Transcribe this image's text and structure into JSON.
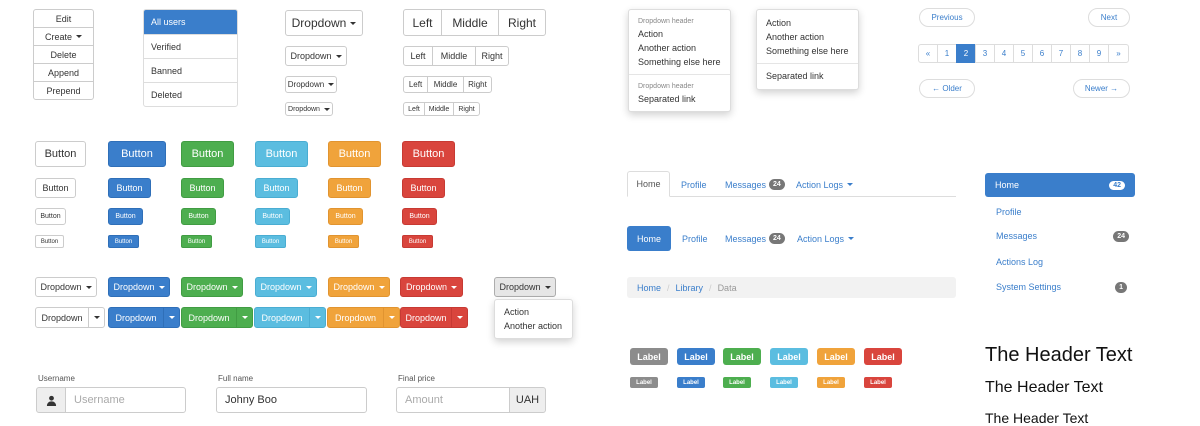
{
  "vgroup": [
    "Edit",
    "Create",
    "Delete",
    "Append",
    "Prepend"
  ],
  "list_group": [
    "All users",
    "Verified",
    "Banned",
    "Deleted"
  ],
  "dropdowns": {
    "label": "Dropdown"
  },
  "bgroup": {
    "left": "Left",
    "middle": "Middle",
    "right": "Right"
  },
  "dropdown_menu1": {
    "header1": "Dropdown header",
    "items1": [
      "Action",
      "Another action",
      "Something else here"
    ],
    "header2": "Dropdown header",
    "items2": [
      "Separated link"
    ]
  },
  "dropdown_menu2": {
    "items": [
      "Action",
      "Another action",
      "Something else here"
    ],
    "sep_item": "Separated link"
  },
  "pager": {
    "previous": "Previous",
    "next": "Next",
    "older": "← Older",
    "newer": "Newer →"
  },
  "pagination": [
    "«",
    "1",
    "2",
    "3",
    "4",
    "5",
    "6",
    "7",
    "8",
    "9",
    "»"
  ],
  "pagination_active": "2",
  "buttons": {
    "label": "Button"
  },
  "dropdown_open": {
    "items": [
      "Action",
      "Another action"
    ]
  },
  "tabs": {
    "home": "Home",
    "profile": "Profile",
    "messages": "Messages",
    "messages_badge": "24",
    "action_logs": "Action Logs"
  },
  "breadcrumb": [
    "Home",
    "Library",
    "Data"
  ],
  "side_nav": [
    {
      "label": "Home",
      "badge": "42"
    },
    {
      "label": "Profile",
      "badge": ""
    },
    {
      "label": "Messages",
      "badge": "24"
    },
    {
      "label": "Actions Log",
      "badge": ""
    },
    {
      "label": "System Settings",
      "badge": "1"
    }
  ],
  "labels": {
    "label": "Label"
  },
  "headers": {
    "h1": "The Header Text",
    "h2": "The Header Text",
    "h3": "The Header Text"
  },
  "form": {
    "username_label": "Username",
    "username_placeholder": "Username",
    "fullname_label": "Full name",
    "fullname_value": "Johny Boo",
    "price_label": "Final price",
    "price_placeholder": "Amount",
    "currency": "UAH"
  },
  "colors": {
    "primary": "#3a7ecb",
    "success": "#4dae4f",
    "info": "#5bbde0",
    "warning": "#f0a33b",
    "danger": "#d9453d",
    "default": "#8c8c8c"
  }
}
